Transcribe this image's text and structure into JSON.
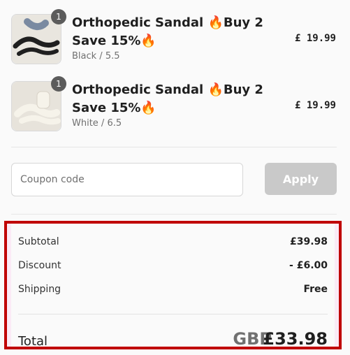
{
  "cart": {
    "items": [
      {
        "title": "Orthopedic Sandal 🔥Buy 2 Save 15%🔥",
        "variant": "Black / 5.5",
        "price": "£ 19.99",
        "quantity": "1",
        "image_color": "#2a2a2a"
      },
      {
        "title": "Orthopedic Sandal 🔥Buy 2 Save 15%🔥",
        "variant": "White / 6.5",
        "price": "£ 19.99",
        "quantity": "1",
        "image_color": "#f1efe7"
      }
    ]
  },
  "coupon": {
    "placeholder": "Coupon code",
    "apply_label": "Apply"
  },
  "summary": {
    "subtotal_label": "Subtotal",
    "subtotal_value": "£39.98",
    "discount_label": "Discount",
    "discount_value": "- £6.00",
    "shipping_label": "Shipping",
    "shipping_value": "Free",
    "total_label": "Total",
    "total_currency": "GBP",
    "total_value": "£33.98"
  },
  "colors": {
    "accent_highlight": "#c00000",
    "apply_button": "#c9c9c9"
  }
}
